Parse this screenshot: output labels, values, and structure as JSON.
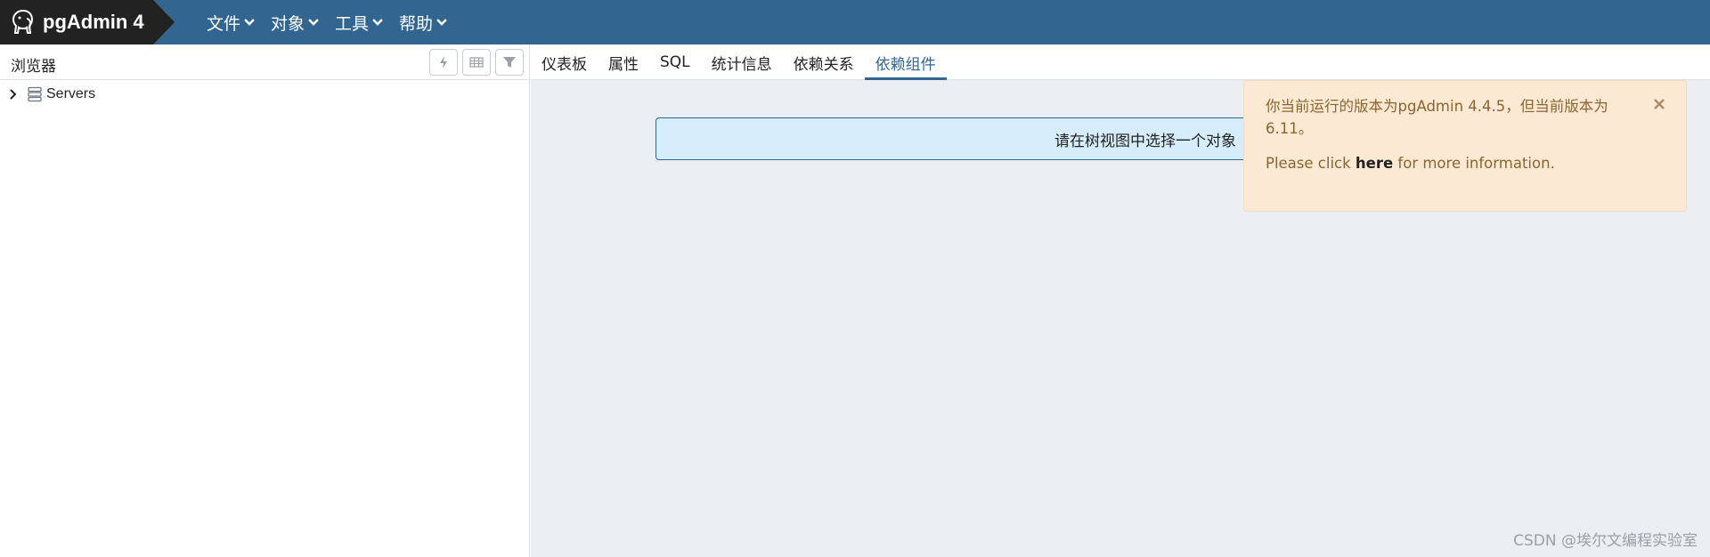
{
  "brand": {
    "name": "pgAdmin 4"
  },
  "menus": [
    {
      "label": "文件"
    },
    {
      "label": "对象"
    },
    {
      "label": "工具"
    },
    {
      "label": "帮助"
    }
  ],
  "browser": {
    "title": "浏览器",
    "toolbar_icons": [
      "lightning-icon",
      "grid-icon",
      "filter-icon"
    ],
    "tree": [
      {
        "label": "Servers",
        "icon": "server-icon",
        "expanded": false
      }
    ]
  },
  "tabs": [
    {
      "label": "仪表板",
      "active": false
    },
    {
      "label": "属性",
      "active": false
    },
    {
      "label": "SQL",
      "active": false
    },
    {
      "label": "统计信息",
      "active": false
    },
    {
      "label": "依赖关系",
      "active": false
    },
    {
      "label": "依赖组件",
      "active": true
    }
  ],
  "content": {
    "message": "请在树视图中选择一个对象"
  },
  "toast": {
    "message": "你当前运行的版本为pgAdmin 4.4.5，但当前版本为6.11。",
    "more_prefix": "Please click ",
    "more_link": "here",
    "more_suffix": " for more information."
  },
  "watermark": "CSDN @埃尔文编程实验室",
  "colors": {
    "navbar": "#326690",
    "brand_bg": "#222222",
    "info_bg": "#d6eefb",
    "toast_bg": "#fce9d4",
    "toast_text": "#8a6530"
  }
}
